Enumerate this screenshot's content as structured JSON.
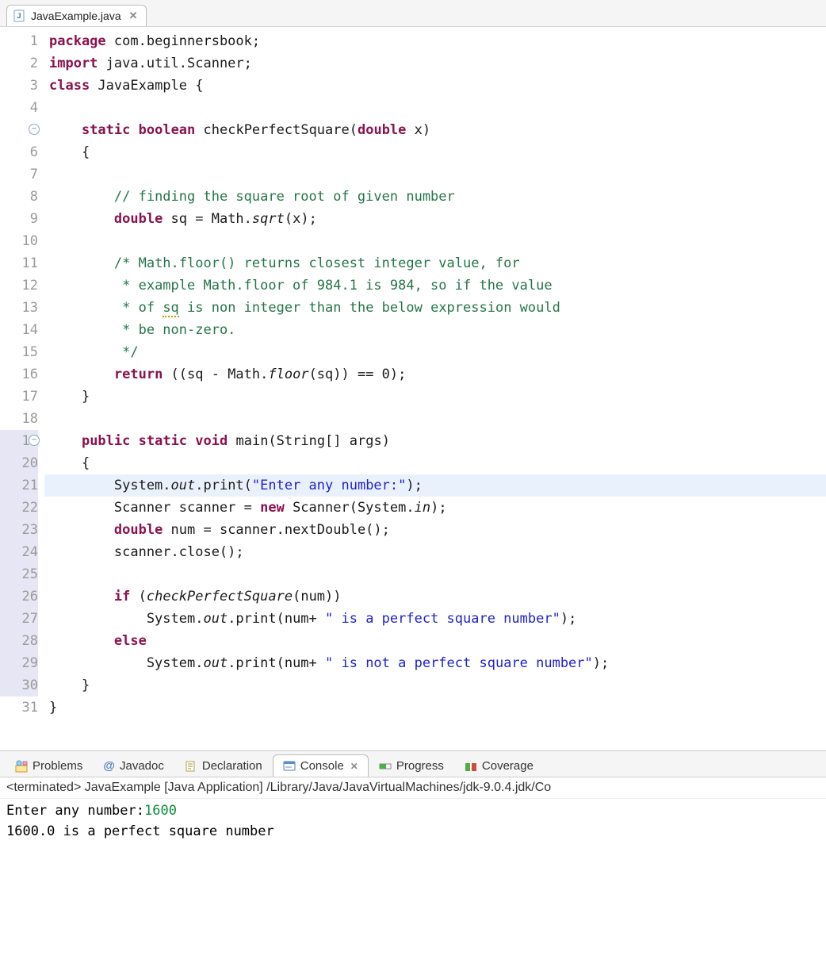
{
  "tab": {
    "filename": "JavaExample.java"
  },
  "code": {
    "lines": [
      {
        "n": "1",
        "fold": false,
        "hl": false,
        "mark": false,
        "tokens": [
          {
            "c": "kw",
            "t": "package"
          },
          {
            "c": "ident",
            "t": " com.beginnersbook;"
          }
        ]
      },
      {
        "n": "2",
        "fold": false,
        "hl": false,
        "mark": false,
        "tokens": [
          {
            "c": "kw",
            "t": "import"
          },
          {
            "c": "ident",
            "t": " java.util.Scanner;"
          }
        ]
      },
      {
        "n": "3",
        "fold": false,
        "hl": false,
        "mark": false,
        "tokens": [
          {
            "c": "kw",
            "t": "class"
          },
          {
            "c": "ident",
            "t": " JavaExample {"
          }
        ]
      },
      {
        "n": "4",
        "fold": false,
        "hl": false,
        "mark": false,
        "tokens": [
          {
            "c": "ident",
            "t": ""
          }
        ]
      },
      {
        "n": "5",
        "fold": true,
        "hl": false,
        "mark": false,
        "tokens": [
          {
            "c": "ident",
            "t": "    "
          },
          {
            "c": "kw",
            "t": "static"
          },
          {
            "c": "ident",
            "t": " "
          },
          {
            "c": "kw",
            "t": "boolean"
          },
          {
            "c": "ident",
            "t": " checkPerfectSquare("
          },
          {
            "c": "kw",
            "t": "double"
          },
          {
            "c": "ident",
            "t": " x)"
          }
        ]
      },
      {
        "n": "6",
        "fold": false,
        "hl": false,
        "mark": false,
        "tokens": [
          {
            "c": "ident",
            "t": "    {"
          }
        ]
      },
      {
        "n": "7",
        "fold": false,
        "hl": false,
        "mark": false,
        "tokens": [
          {
            "c": "ident",
            "t": ""
          }
        ]
      },
      {
        "n": "8",
        "fold": false,
        "hl": false,
        "mark": false,
        "tokens": [
          {
            "c": "ident",
            "t": "        "
          },
          {
            "c": "cmt",
            "t": "// finding the square root of given number"
          }
        ]
      },
      {
        "n": "9",
        "fold": false,
        "hl": false,
        "mark": false,
        "tokens": [
          {
            "c": "ident",
            "t": "        "
          },
          {
            "c": "kw",
            "t": "double"
          },
          {
            "c": "ident",
            "t": " sq = Math."
          },
          {
            "c": "italic",
            "t": "sqrt"
          },
          {
            "c": "ident",
            "t": "(x);"
          }
        ]
      },
      {
        "n": "10",
        "fold": false,
        "hl": false,
        "mark": false,
        "tokens": [
          {
            "c": "ident",
            "t": ""
          }
        ]
      },
      {
        "n": "11",
        "fold": false,
        "hl": false,
        "mark": false,
        "tokens": [
          {
            "c": "ident",
            "t": "        "
          },
          {
            "c": "cmt",
            "t": "/* Math.floor() returns closest integer value, for"
          }
        ]
      },
      {
        "n": "12",
        "fold": false,
        "hl": false,
        "mark": false,
        "tokens": [
          {
            "c": "ident",
            "t": "         "
          },
          {
            "c": "cmt",
            "t": "* example Math.floor of 984.1 is 984, so if the value"
          }
        ]
      },
      {
        "n": "13",
        "fold": false,
        "hl": false,
        "mark": false,
        "tokens": [
          {
            "c": "ident",
            "t": "         "
          },
          {
            "c": "cmt",
            "t": "* of "
          },
          {
            "c": "cmt warn",
            "t": "sq"
          },
          {
            "c": "cmt",
            "t": " is non integer than the below expression would"
          }
        ]
      },
      {
        "n": "14",
        "fold": false,
        "hl": false,
        "mark": false,
        "tokens": [
          {
            "c": "ident",
            "t": "         "
          },
          {
            "c": "cmt",
            "t": "* be non-zero."
          }
        ]
      },
      {
        "n": "15",
        "fold": false,
        "hl": false,
        "mark": false,
        "tokens": [
          {
            "c": "ident",
            "t": "         "
          },
          {
            "c": "cmt",
            "t": "*/"
          }
        ]
      },
      {
        "n": "16",
        "fold": false,
        "hl": false,
        "mark": false,
        "tokens": [
          {
            "c": "ident",
            "t": "        "
          },
          {
            "c": "kw",
            "t": "return"
          },
          {
            "c": "ident",
            "t": " ((sq - Math."
          },
          {
            "c": "italic",
            "t": "floor"
          },
          {
            "c": "ident",
            "t": "(sq)) == 0);"
          }
        ]
      },
      {
        "n": "17",
        "fold": false,
        "hl": false,
        "mark": false,
        "tokens": [
          {
            "c": "ident",
            "t": "    }"
          }
        ]
      },
      {
        "n": "18",
        "fold": false,
        "hl": false,
        "mark": false,
        "tokens": [
          {
            "c": "ident",
            "t": ""
          }
        ]
      },
      {
        "n": "19",
        "fold": true,
        "hl": false,
        "mark": true,
        "tokens": [
          {
            "c": "ident",
            "t": "    "
          },
          {
            "c": "kw",
            "t": "public"
          },
          {
            "c": "ident",
            "t": " "
          },
          {
            "c": "kw",
            "t": "static"
          },
          {
            "c": "ident",
            "t": " "
          },
          {
            "c": "kw",
            "t": "void"
          },
          {
            "c": "ident",
            "t": " main(String[] args)"
          }
        ]
      },
      {
        "n": "20",
        "fold": false,
        "hl": false,
        "mark": true,
        "tokens": [
          {
            "c": "ident",
            "t": "    {"
          }
        ]
      },
      {
        "n": "21",
        "fold": false,
        "hl": true,
        "mark": true,
        "tokens": [
          {
            "c": "ident",
            "t": "        System."
          },
          {
            "c": "italic",
            "t": "out"
          },
          {
            "c": "ident",
            "t": ".print("
          },
          {
            "c": "str",
            "t": "\"Enter any number:\""
          },
          {
            "c": "ident",
            "t": ");"
          }
        ]
      },
      {
        "n": "22",
        "fold": false,
        "hl": false,
        "mark": true,
        "tokens": [
          {
            "c": "ident",
            "t": "        Scanner scanner = "
          },
          {
            "c": "kw",
            "t": "new"
          },
          {
            "c": "ident",
            "t": " Scanner(System."
          },
          {
            "c": "italic",
            "t": "in"
          },
          {
            "c": "ident",
            "t": ");"
          }
        ]
      },
      {
        "n": "23",
        "fold": false,
        "hl": false,
        "mark": true,
        "tokens": [
          {
            "c": "ident",
            "t": "        "
          },
          {
            "c": "kw",
            "t": "double"
          },
          {
            "c": "ident",
            "t": " num = scanner.nextDouble();"
          }
        ]
      },
      {
        "n": "24",
        "fold": false,
        "hl": false,
        "mark": true,
        "tokens": [
          {
            "c": "ident",
            "t": "        scanner.close();"
          }
        ]
      },
      {
        "n": "25",
        "fold": false,
        "hl": false,
        "mark": true,
        "tokens": [
          {
            "c": "ident",
            "t": ""
          }
        ]
      },
      {
        "n": "26",
        "fold": false,
        "hl": false,
        "mark": true,
        "tokens": [
          {
            "c": "ident",
            "t": "        "
          },
          {
            "c": "kw",
            "t": "if"
          },
          {
            "c": "ident",
            "t": " ("
          },
          {
            "c": "italic",
            "t": "checkPerfectSquare"
          },
          {
            "c": "ident",
            "t": "(num))"
          }
        ]
      },
      {
        "n": "27",
        "fold": false,
        "hl": false,
        "mark": true,
        "tokens": [
          {
            "c": "ident",
            "t": "            System."
          },
          {
            "c": "italic",
            "t": "out"
          },
          {
            "c": "ident",
            "t": ".print(num+ "
          },
          {
            "c": "str",
            "t": "\" is a perfect square number\""
          },
          {
            "c": "ident",
            "t": ");"
          }
        ]
      },
      {
        "n": "28",
        "fold": false,
        "hl": false,
        "mark": true,
        "tokens": [
          {
            "c": "ident",
            "t": "        "
          },
          {
            "c": "kw",
            "t": "else"
          }
        ]
      },
      {
        "n": "29",
        "fold": false,
        "hl": false,
        "mark": true,
        "tokens": [
          {
            "c": "ident",
            "t": "            System."
          },
          {
            "c": "italic",
            "t": "out"
          },
          {
            "c": "ident",
            "t": ".print(num+ "
          },
          {
            "c": "str",
            "t": "\" is not a perfect square number\""
          },
          {
            "c": "ident",
            "t": ");"
          }
        ]
      },
      {
        "n": "30",
        "fold": false,
        "hl": false,
        "mark": true,
        "tokens": [
          {
            "c": "ident",
            "t": "    }"
          }
        ]
      },
      {
        "n": "31",
        "fold": false,
        "hl": false,
        "mark": false,
        "tokens": [
          {
            "c": "ident",
            "t": "}"
          }
        ]
      }
    ]
  },
  "bottomTabs": {
    "problems": "Problems",
    "javadoc": "Javadoc",
    "declaration": "Declaration",
    "console": "Console",
    "progress": "Progress",
    "coverage": "Coverage"
  },
  "console": {
    "header": "<terminated> JavaExample [Java Application] /Library/Java/JavaVirtualMachines/jdk-9.0.4.jdk/Co",
    "prompt": "Enter any number:",
    "input": "1600",
    "output": "1600.0 is a perfect square number"
  }
}
